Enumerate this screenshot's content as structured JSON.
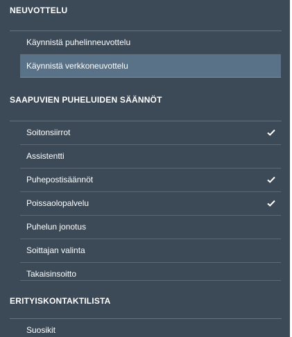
{
  "sections": [
    {
      "title": "NEUVOTTELU",
      "items": [
        {
          "label": "Käynnistä puhelinneuvottelu",
          "checked": false,
          "selected": false
        },
        {
          "label": "Käynnistä verkkoneuvottelu",
          "checked": false,
          "selected": true
        }
      ]
    },
    {
      "title": "SAAPUVIEN PUHELUIDEN SÄÄNNÖT",
      "items": [
        {
          "label": "Soitonsiirrot",
          "checked": true,
          "selected": false
        },
        {
          "label": "Assistentti",
          "checked": false,
          "selected": false
        },
        {
          "label": "Puhepostisäännöt",
          "checked": true,
          "selected": false
        },
        {
          "label": "Poissaolopalvelu",
          "checked": true,
          "selected": false
        },
        {
          "label": "Puhelun jonotus",
          "checked": false,
          "selected": false
        },
        {
          "label": "Soittajan valinta",
          "checked": false,
          "selected": false
        },
        {
          "label": "Takaisinsoitto",
          "checked": false,
          "selected": false
        }
      ]
    },
    {
      "title": "ERITYISKONTAKTILISTA",
      "items": [
        {
          "label": "Suosikit",
          "checked": false,
          "selected": false
        }
      ]
    }
  ],
  "colors": {
    "panel_bg": "#3c4a58",
    "selected_bg": "#5a7287",
    "divider": "#67747f",
    "text": "#ffffff"
  },
  "icons": {
    "check": "check-icon"
  }
}
